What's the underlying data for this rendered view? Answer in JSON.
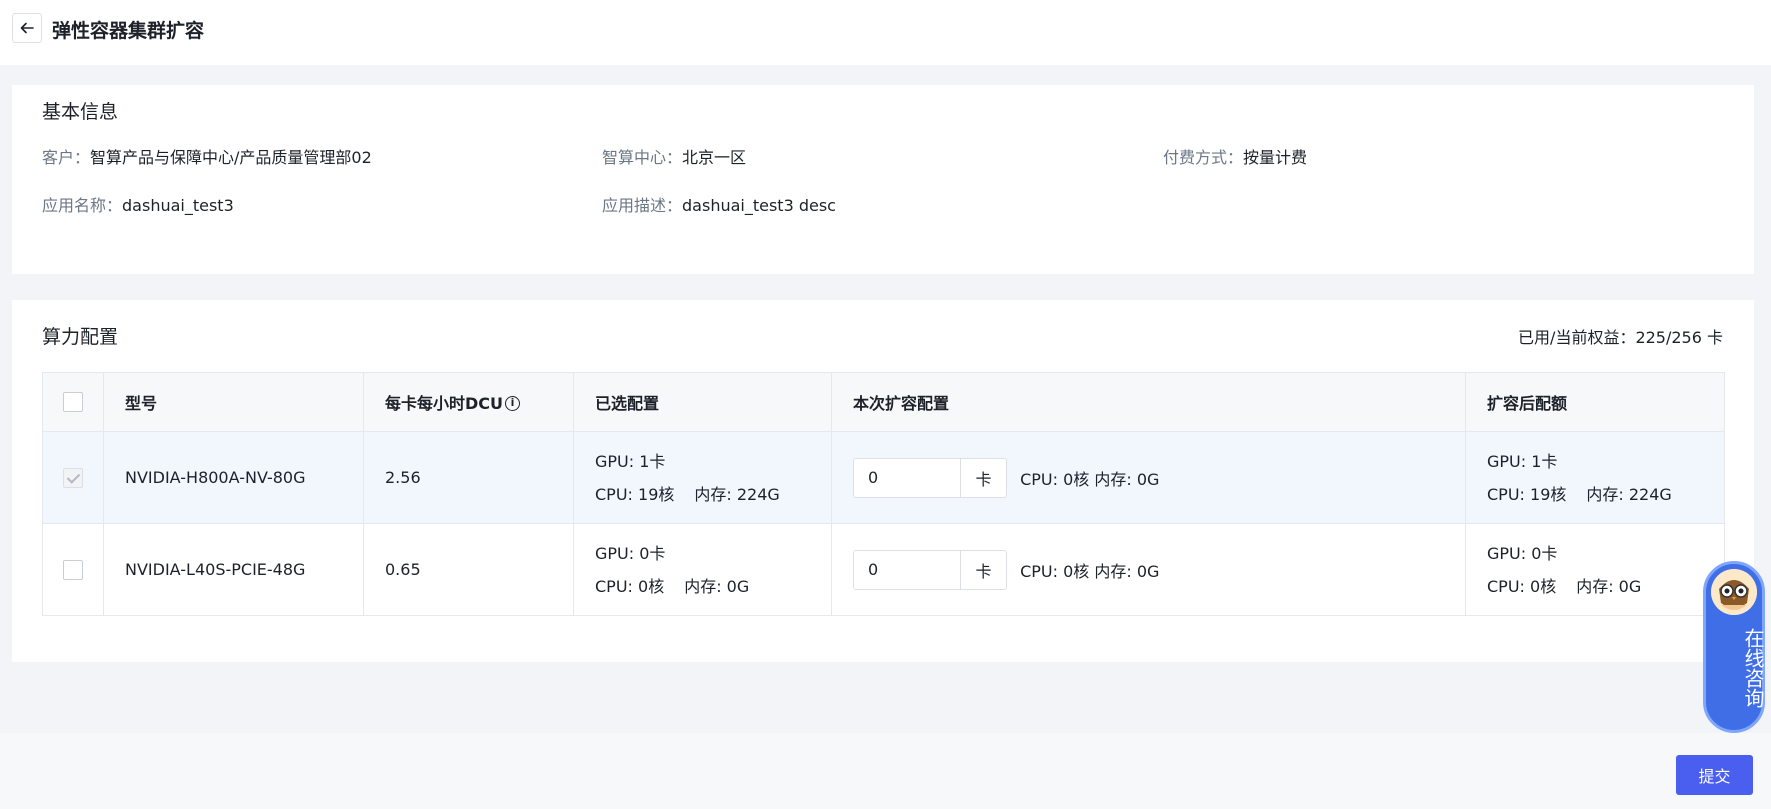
{
  "header": {
    "title": "弹性容器集群扩容"
  },
  "basic_info": {
    "title": "基本信息",
    "customer_label": "客户：",
    "customer_value": "智算产品与保障中心/产品质量管理部02",
    "center_label": "智算中心：",
    "center_value": "北京一区",
    "payment_label": "付费方式：",
    "payment_value": "按量计费",
    "app_name_label": "应用名称：",
    "app_name_value": "dashuai_test3",
    "app_desc_label": "应用描述：",
    "app_desc_value": "dashuai_test3 desc"
  },
  "compute": {
    "title": "算力配置",
    "quota_text": "已用/当前权益：225/256 卡",
    "columns": {
      "model": "型号",
      "dcu": "每卡每小时DCU",
      "selected": "已选配置",
      "expand": "本次扩容配置",
      "after": "扩容后配额"
    },
    "rows": [
      {
        "model": "NVIDIA-H800A-NV-80G",
        "dcu": "2.56",
        "sel_gpu": "GPU: 1卡",
        "sel_cpu": "CPU: 19核",
        "sel_mem": "内存: 224G",
        "expand_value": "0",
        "expand_unit": "卡",
        "expand_cpu": "CPU: 0核",
        "expand_mem": "内存: 0G",
        "after_gpu": "GPU: 1卡",
        "after_cpu": "CPU: 19核",
        "after_mem": "内存: 224G"
      },
      {
        "model": "NVIDIA-L40S-PCIE-48G",
        "dcu": "0.65",
        "sel_gpu": "GPU: 0卡",
        "sel_cpu": "CPU: 0核",
        "sel_mem": "内存: 0G",
        "expand_value": "0",
        "expand_unit": "卡",
        "expand_cpu": "CPU: 0核",
        "expand_mem": "内存: 0G",
        "after_gpu": "GPU: 0卡",
        "after_cpu": "CPU: 0核",
        "after_mem": "内存: 0G"
      }
    ]
  },
  "footer": {
    "submit_label": "提交"
  },
  "consult": {
    "label": "在线咨询"
  },
  "colors": {
    "accent": "#4a5ef0",
    "consult_bg": "#3f6ee6",
    "page_bg": "#f2f4f8"
  }
}
